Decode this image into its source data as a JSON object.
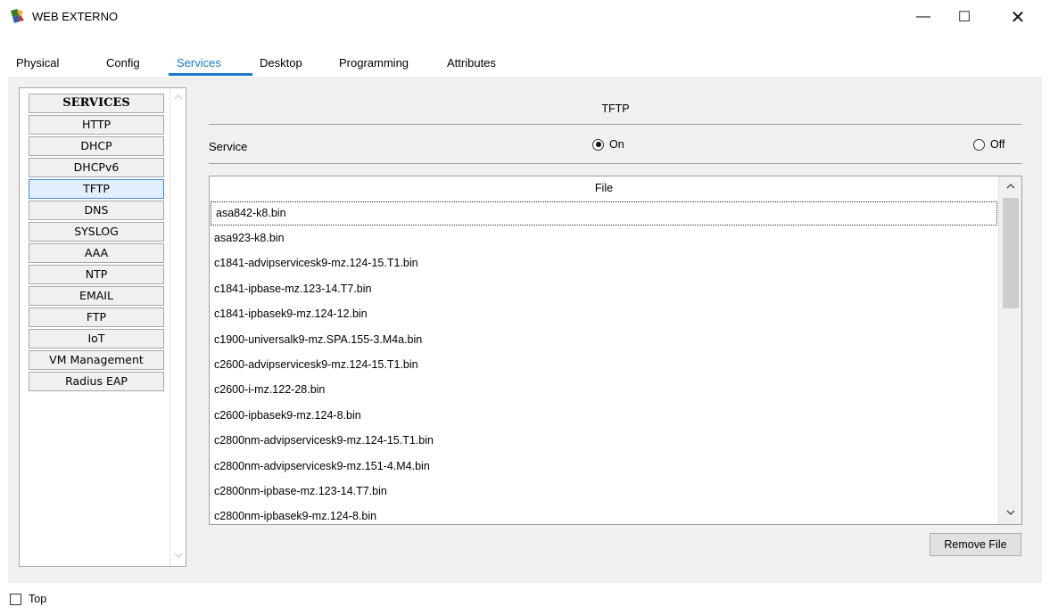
{
  "window": {
    "title": "WEB EXTERNO",
    "minimize_glyph": "—",
    "maximize_glyph": "☐",
    "close_glyph": "✕"
  },
  "tabs": [
    {
      "label": "Physical",
      "active": false
    },
    {
      "label": "Config",
      "active": false
    },
    {
      "label": "Services",
      "active": true
    },
    {
      "label": "Desktop",
      "active": false
    },
    {
      "label": "Programming",
      "active": false
    },
    {
      "label": "Attributes",
      "active": false
    }
  ],
  "services": {
    "header": "SERVICES",
    "items": [
      "HTTP",
      "DHCP",
      "DHCPv6",
      "TFTP",
      "DNS",
      "SYSLOG",
      "AAA",
      "NTP",
      "EMAIL",
      "FTP",
      "IoT",
      "VM Management",
      "Radius EAP"
    ],
    "selected": "TFTP"
  },
  "tftp": {
    "title": "TFTP",
    "service_label": "Service",
    "on_label": "On",
    "off_label": "Off",
    "state": "On",
    "file_header": "File",
    "files": [
      "asa842-k8.bin",
      "asa923-k8.bin",
      "c1841-advipservicesk9-mz.124-15.T1.bin",
      "c1841-ipbase-mz.123-14.T7.bin",
      "c1841-ipbasek9-mz.124-12.bin",
      "c1900-universalk9-mz.SPA.155-3.M4a.bin",
      "c2600-advipservicesk9-mz.124-15.T1.bin",
      "c2600-i-mz.122-28.bin",
      "c2600-ipbasek9-mz.124-8.bin",
      "c2800nm-advipservicesk9-mz.124-15.T1.bin",
      "c2800nm-advipservicesk9-mz.151-4.M4.bin",
      "c2800nm-ipbase-mz.123-14.T7.bin",
      "c2800nm-ipbasek9-mz.124-8.bin"
    ],
    "remove_button": "Remove File"
  },
  "footer": {
    "top_label": "Top",
    "top_checked": false
  },
  "colors": {
    "accent": "#1b79c8",
    "panel_bg": "#f0f0f0",
    "selected_border": "#3c8ad9"
  },
  "icons": {
    "app": "packet-tracer-server-icon",
    "scroll_up": "chevron-up-icon",
    "scroll_down": "chevron-down-icon"
  }
}
